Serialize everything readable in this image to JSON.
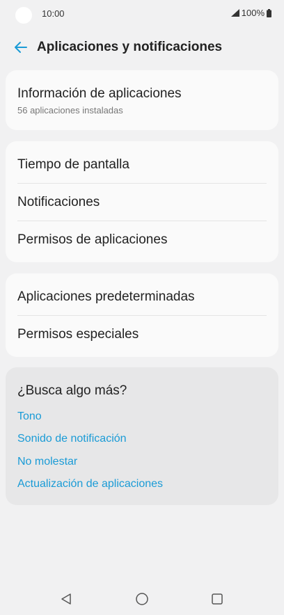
{
  "status_bar": {
    "time": "10:00",
    "battery": "100%"
  },
  "header": {
    "title": "Aplicaciones y notificaciones"
  },
  "app_info": {
    "title": "Información de aplicaciones",
    "subtitle": "56 aplicaciones instaladas"
  },
  "group1": {
    "items": [
      "Tiempo de pantalla",
      "Notificaciones",
      "Permisos de aplicaciones"
    ]
  },
  "group2": {
    "items": [
      "Aplicaciones predeterminadas",
      "Permisos especiales"
    ]
  },
  "suggestions": {
    "title": "¿Busca algo más?",
    "links": [
      "Tono",
      "Sonido de notificación",
      "No molestar",
      "Actualización de aplicaciones"
    ]
  },
  "colors": {
    "accent": "#1a9bd6",
    "background": "#f1f1f2",
    "card": "#fafafa",
    "suggest_card": "#e7e7e8"
  },
  "icons": {
    "back": "arrow-left-icon",
    "nav_back": "triangle-back-icon",
    "nav_home": "circle-home-icon",
    "nav_recent": "square-recent-icon"
  }
}
